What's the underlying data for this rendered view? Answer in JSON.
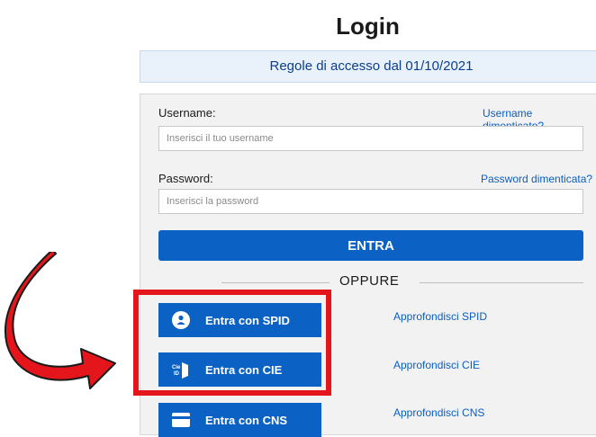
{
  "page": {
    "title": "Login",
    "notice": "Regole di accesso dal 01/10/2021"
  },
  "form": {
    "username_label": "Username:",
    "username_forgot": "Username dimenticato?",
    "username_placeholder": "Inserisci il tuo username",
    "password_label": "Password:",
    "password_forgot": "Password dimenticata?",
    "password_placeholder": "Inserisci la password",
    "submit_label": "ENTRA"
  },
  "divider": {
    "text": "OPPURE"
  },
  "identity_buttons": [
    {
      "label": "Entra con SPID",
      "icon": "spid-user-icon",
      "more": "Approfondisci SPID"
    },
    {
      "label": "Entra con CIE",
      "icon": "cie-card-icon",
      "more": "Approfondisci CIE"
    },
    {
      "label": "Entra con CNS",
      "icon": "cns-card-icon",
      "more": "Approfondisci CNS"
    }
  ],
  "colors": {
    "primary": "#0b62c4",
    "link": "#0a5ec2",
    "annotation_red": "#e4161c"
  }
}
